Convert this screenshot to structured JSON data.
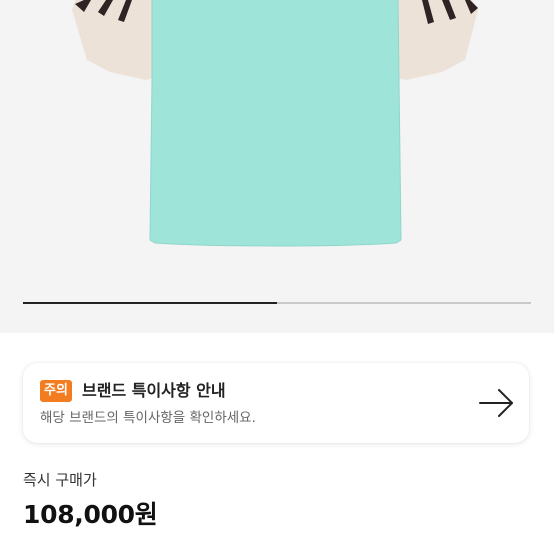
{
  "product_image": {
    "icon": "tshirt-product-image",
    "colors": {
      "body": "#9ee4d9",
      "sleeve": "#ede2d8",
      "stripe": "#2f2323",
      "background": "#f4f4f4"
    }
  },
  "carousel": {
    "progress_fraction": 0.5
  },
  "notice": {
    "badge": "주의",
    "title": "브랜드 특이사항 안내",
    "description": "해당 브랜드의 특이사항을 확인하세요.",
    "icon": "arrow-right-icon",
    "badge_color": "#f47c20"
  },
  "price": {
    "label": "즉시 구매가",
    "value": "108,000원"
  }
}
